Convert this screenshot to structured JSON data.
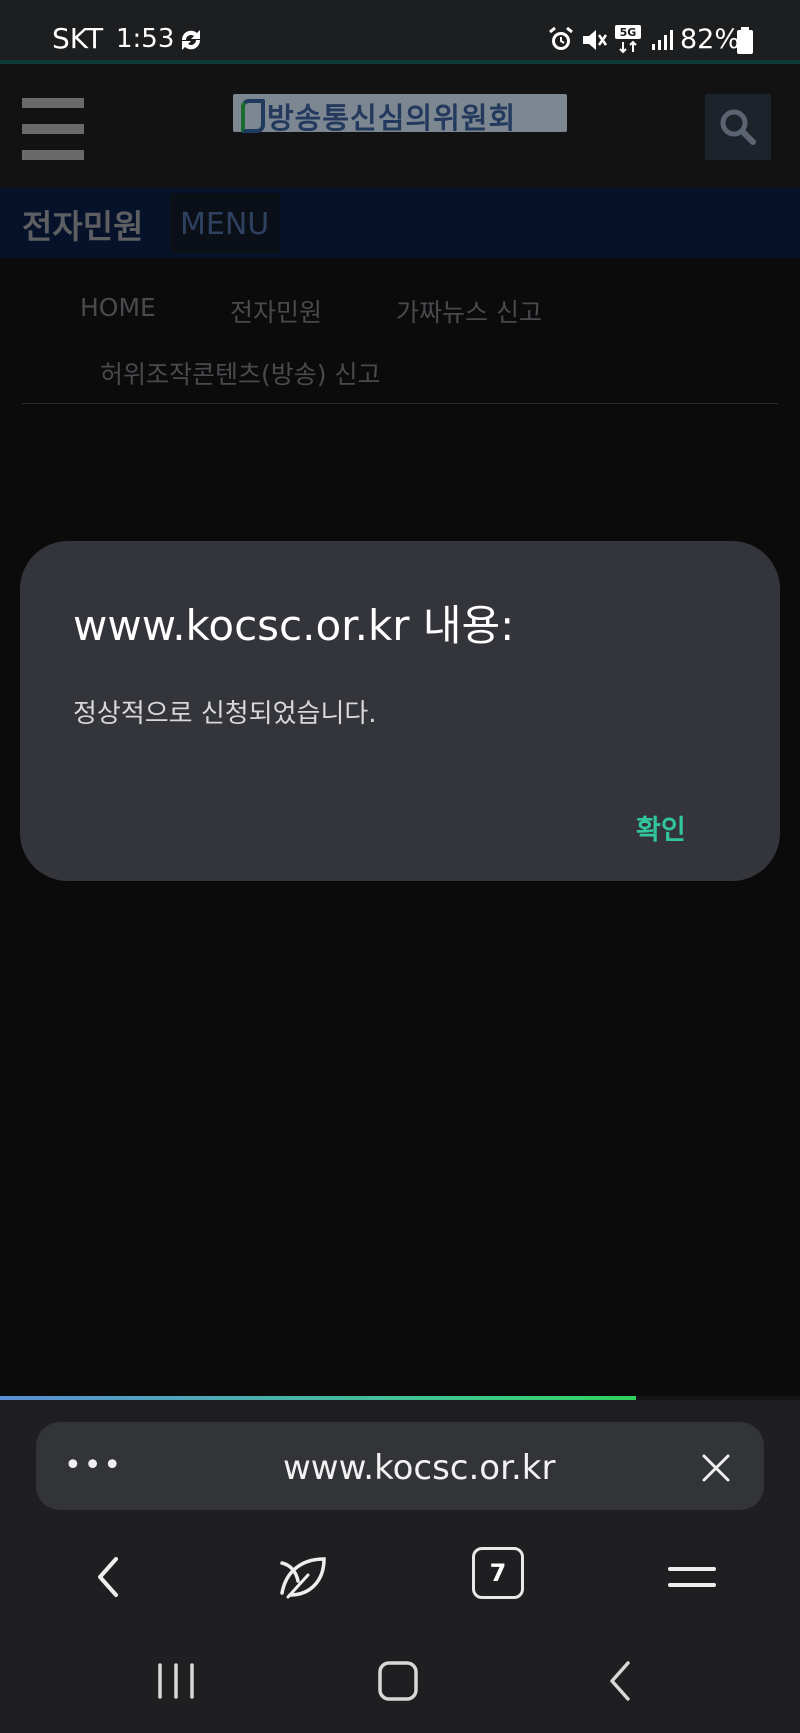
{
  "status_bar": {
    "carrier": "SKT",
    "time": "1:53",
    "battery": "82%",
    "icons": [
      "sync-icon",
      "alarm-icon",
      "mute-icon",
      "5g-icon",
      "signal-icon",
      "battery-icon"
    ]
  },
  "header": {
    "logo_text": "방송통신심의위원회",
    "menu_icon": "hamburger-icon",
    "search_icon": "search-icon"
  },
  "subnav": {
    "title": "전자민원",
    "menu_label": "MENU"
  },
  "breadcrumb": {
    "items": [
      "HOME",
      "전자민원",
      "가짜뉴스 신고",
      "허위조작콘텐츠(방송) 신고"
    ]
  },
  "dialog": {
    "title": "www.kocsc.or.kr 내용:",
    "message": "정상적으로 신청되었습니다.",
    "ok_label": "확인"
  },
  "browser": {
    "url": "www.kocsc.or.kr",
    "more_label": "•••",
    "tab_count": "7",
    "load_progress": 0.795,
    "accent": "#31c79a"
  },
  "system_nav": {
    "icons": [
      "recents-icon",
      "home-icon",
      "back-icon"
    ]
  }
}
